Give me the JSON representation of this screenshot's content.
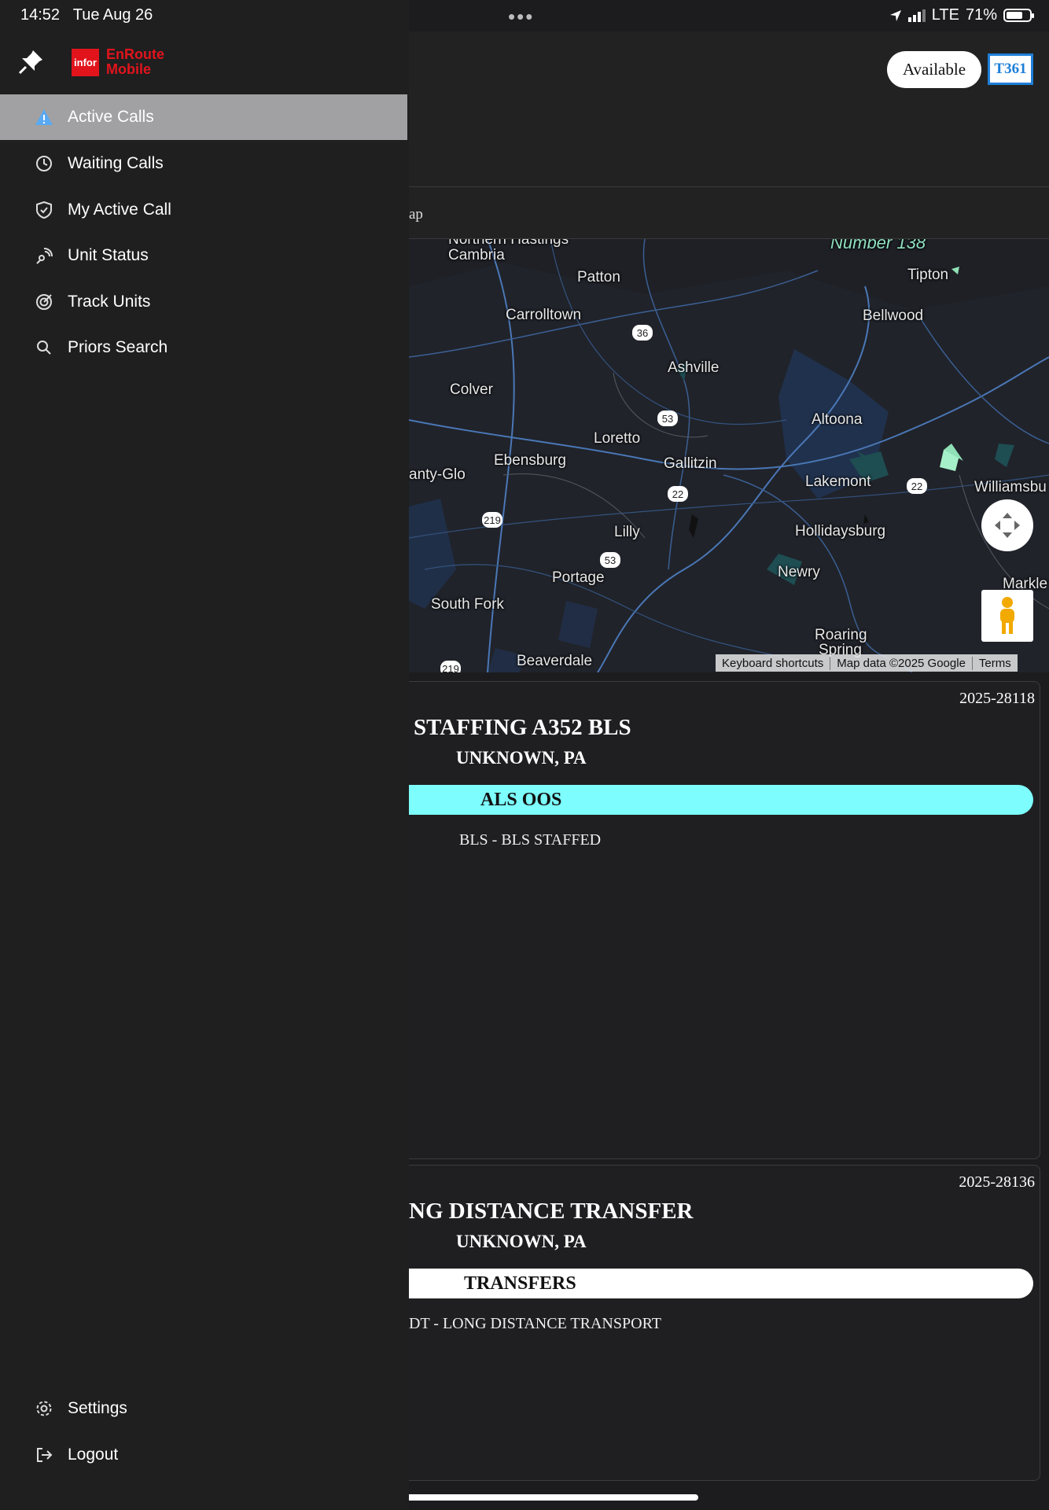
{
  "status_bar": {
    "time": "14:52",
    "date": "Tue Aug 26",
    "network": "LTE",
    "battery": "71%",
    "battery_level": 0.71
  },
  "app": {
    "logo_box": "infor",
    "logo_line1": "EnRoute",
    "logo_line2": "Mobile"
  },
  "header": {
    "status": "Available",
    "unit": "T361",
    "tab_label_partial": "ap"
  },
  "sidebar": {
    "items": [
      {
        "label": "Active Calls",
        "icon": "warning-icon",
        "active": true
      },
      {
        "label": "Waiting Calls",
        "icon": "clock-icon",
        "active": false
      },
      {
        "label": "My Active Call",
        "icon": "shield-check-icon",
        "active": false
      },
      {
        "label": "Unit Status",
        "icon": "signal-icon",
        "active": false
      },
      {
        "label": "Track Units",
        "icon": "target-icon",
        "active": false
      },
      {
        "label": "Priors Search",
        "icon": "search-icon",
        "active": false
      }
    ],
    "bottom": [
      {
        "label": "Settings",
        "icon": "gear-icon"
      },
      {
        "label": "Logout",
        "icon": "logout-icon"
      }
    ]
  },
  "map": {
    "labels": {
      "northern_cambria": "Cambria",
      "northern_hastings": "Northern Hastings",
      "number138": "Number 138",
      "patton": "Patton",
      "tipton": "Tipton",
      "carrolltown": "Carrolltown",
      "bellwood": "Bellwood",
      "ashville": "Ashville",
      "colver": "Colver",
      "altoona": "Altoona",
      "loretto": "Loretto",
      "ebensburg": "Ebensburg",
      "gallitzin": "Gallitzin",
      "nanty_glo": "anty-Glo",
      "lakemont": "Lakemont",
      "williamsburg": "Williamsbu",
      "lilly": "Lilly",
      "hollidaysburg": "Hollidaysburg",
      "portage": "Portage",
      "newry": "Newry",
      "south_fork": "South Fork",
      "markle": "Markle",
      "roaring_spring_1": "Roaring",
      "roaring_spring_2": "Spring",
      "beaverdale": "Beaverdale"
    },
    "shields": {
      "r36": "36",
      "r53a": "53",
      "r22a": "22",
      "r22b": "22",
      "r219a": "219",
      "r53b": "53",
      "r219b": "219"
    },
    "attribution": {
      "shortcuts": "Keyboard shortcuts",
      "data": "Map data ©2025 Google",
      "terms": "Terms"
    }
  },
  "calls": [
    {
      "number": "2025-28118",
      "title": "STAFFING A352 BLS",
      "location": "UNKNOWN, PA",
      "type": "ALS OOS",
      "type_color": "#7dfdfd",
      "subtype": "BLS - BLS STAFFED"
    },
    {
      "number": "2025-28136",
      "title": "NG DISTANCE TRANSFER",
      "location": "UNKNOWN, PA",
      "type": "TRANSFERS",
      "type_color": "#ffffff",
      "subtype": "DT - LONG DISTANCE TRANSPORT"
    }
  ]
}
